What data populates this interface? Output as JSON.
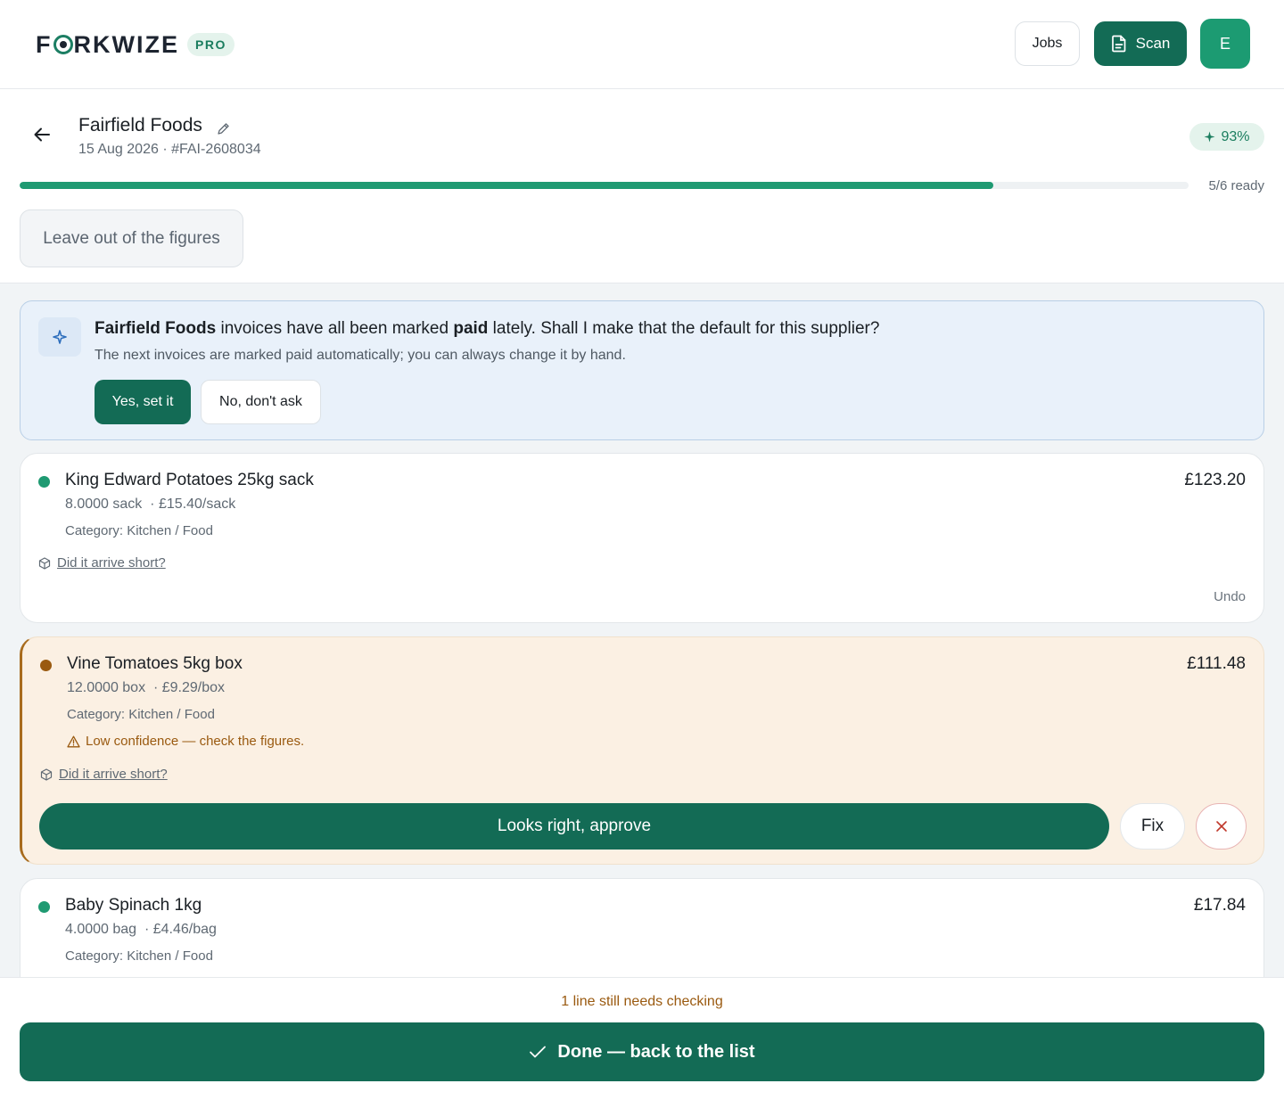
{
  "app": {
    "logo": "FORKWIZE",
    "logo_before": "F",
    "logo_after": "RKWIZE",
    "plan_badge": "PRO",
    "nav": {
      "jobs": "Jobs",
      "scan": "Scan",
      "avatar_initial": "E"
    }
  },
  "invoice": {
    "supplier": "Fairfield Foods",
    "date": "15 Aug 2026",
    "number": "#FAI-2608034",
    "meta": "15 Aug 2026 · #FAI-2608034",
    "confidence": "93%",
    "progress": 0.8333,
    "ready_text": "5/6 ready",
    "leave_out_label": "Leave out of the figures"
  },
  "suggestion": {
    "supplier": "Fairfield Foods",
    "text_a": " invoices have all been marked ",
    "status": "paid",
    "text_b": " lately. Shall I make that the default for this supplier?",
    "subtitle": "The next invoices are marked paid automatically; you can always change it by hand.",
    "yes_label": "Yes, set it",
    "no_label": "No, don't ask"
  },
  "lines": [
    {
      "name": "King Edward Potatoes 25kg sack",
      "price": "£123.20",
      "qty": "8.0000 sack",
      "unit_price": "· £15.40/sack",
      "category": "Category: Kitchen / Food",
      "short_link": "Did it arrive short?",
      "undo": "Undo",
      "status_color": "#1f9a72"
    },
    {
      "name": "Vine Tomatoes 5kg box",
      "price": "£111.48",
      "qty": "12.0000 box",
      "unit_price": "· £9.29/box",
      "category": "Category: Kitchen / Food",
      "warning": "Low confidence — check the figures.",
      "short_link": "Did it arrive short?",
      "approve_label": "Looks right, approve",
      "fix_label": "Fix",
      "status_color": "#a86b1d"
    },
    {
      "name": "Baby Spinach 1kg",
      "price": "£17.84",
      "qty": "4.0000 bag",
      "unit_price": "· £4.46/bag",
      "category": "Category: Kitchen / Food",
      "status_color": "#1f9a72"
    }
  ],
  "footer": {
    "note": "1 line still needs checking",
    "done_label": "Done — back to the list"
  },
  "colors": {
    "brand": "#136b55",
    "accent_green": "#1f9a72",
    "warning": "#a86b1d",
    "info_bg": "#e9f1fa"
  },
  "icons": [
    "back-arrow-icon",
    "pencil-icon",
    "sparkle-icon",
    "document-icon",
    "box-icon",
    "warning-triangle-icon",
    "close-icon",
    "check-icon"
  ]
}
